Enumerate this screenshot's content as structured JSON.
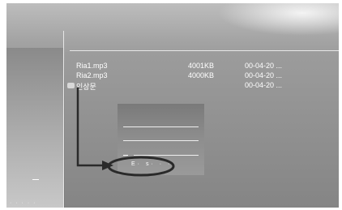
{
  "files": [
    {
      "name": "Ria1.mp3",
      "size": "4001KB",
      "date": "00-04-20 ..."
    },
    {
      "name": "Ria2.mp3",
      "size": "4000KB",
      "date": "00-04-20 ..."
    },
    {
      "name": "인상문",
      "size": "",
      "date": "00-04-20 ..."
    }
  ],
  "popup": {
    "highlighted_item": "E· s· · ·"
  },
  "sidebar": {
    "label": "· · · · ·"
  },
  "colors": {
    "arrow": "#2a2a2a",
    "text": "#ffffff"
  }
}
